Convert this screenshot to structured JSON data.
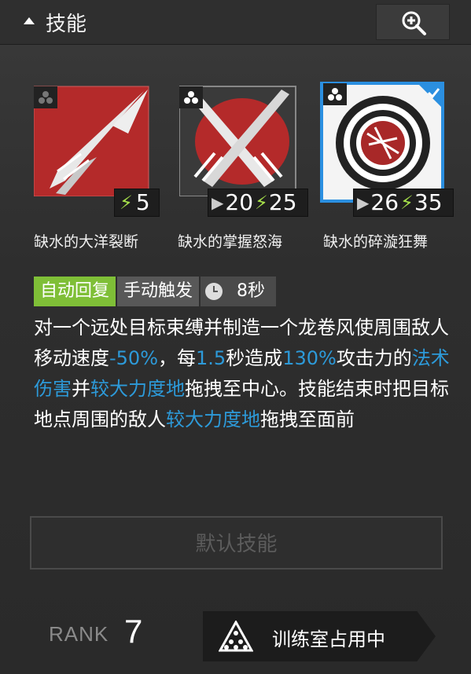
{
  "header": {
    "title": "技能",
    "zoom_icon": "magnifier-plus-icon"
  },
  "skills": [
    {
      "name": "缺水的大洋裂断",
      "sp_cost": "5",
      "initial_sp": "",
      "selected": false
    },
    {
      "name": "缺水的掌握怒海",
      "initial_sp": "20",
      "sp_cost": "25",
      "selected": false
    },
    {
      "name": "缺水的碎漩狂舞",
      "initial_sp": "26",
      "sp_cost": "35",
      "selected": true
    }
  ],
  "tags": {
    "recovery": "自动回复",
    "trigger": "手动触发",
    "duration": "8秒"
  },
  "description": {
    "p1": "对一个远处目标束缚并制造一个龙卷风使周围敌人移动速度",
    "h1": "-50%",
    "p2": "，每",
    "h2": "1.5",
    "p3": "秒造成",
    "h3": "130%",
    "p4": "攻击力的",
    "h4": "法术伤害",
    "p5": "并",
    "h5": "较大力度地",
    "p6": "拖拽至中心。技能结束时把目标地点周围的敌人",
    "h6": "较大力度地",
    "p7": "拖拽至面前"
  },
  "default_skill_button": "默认技能",
  "rank": {
    "label": "RANK",
    "value": "7"
  },
  "training": {
    "label": "训练室占用中"
  },
  "colors": {
    "highlight": "#2d9ad9",
    "auto_tag": "#7fbf37",
    "selected_border": "#2b8fe0"
  }
}
